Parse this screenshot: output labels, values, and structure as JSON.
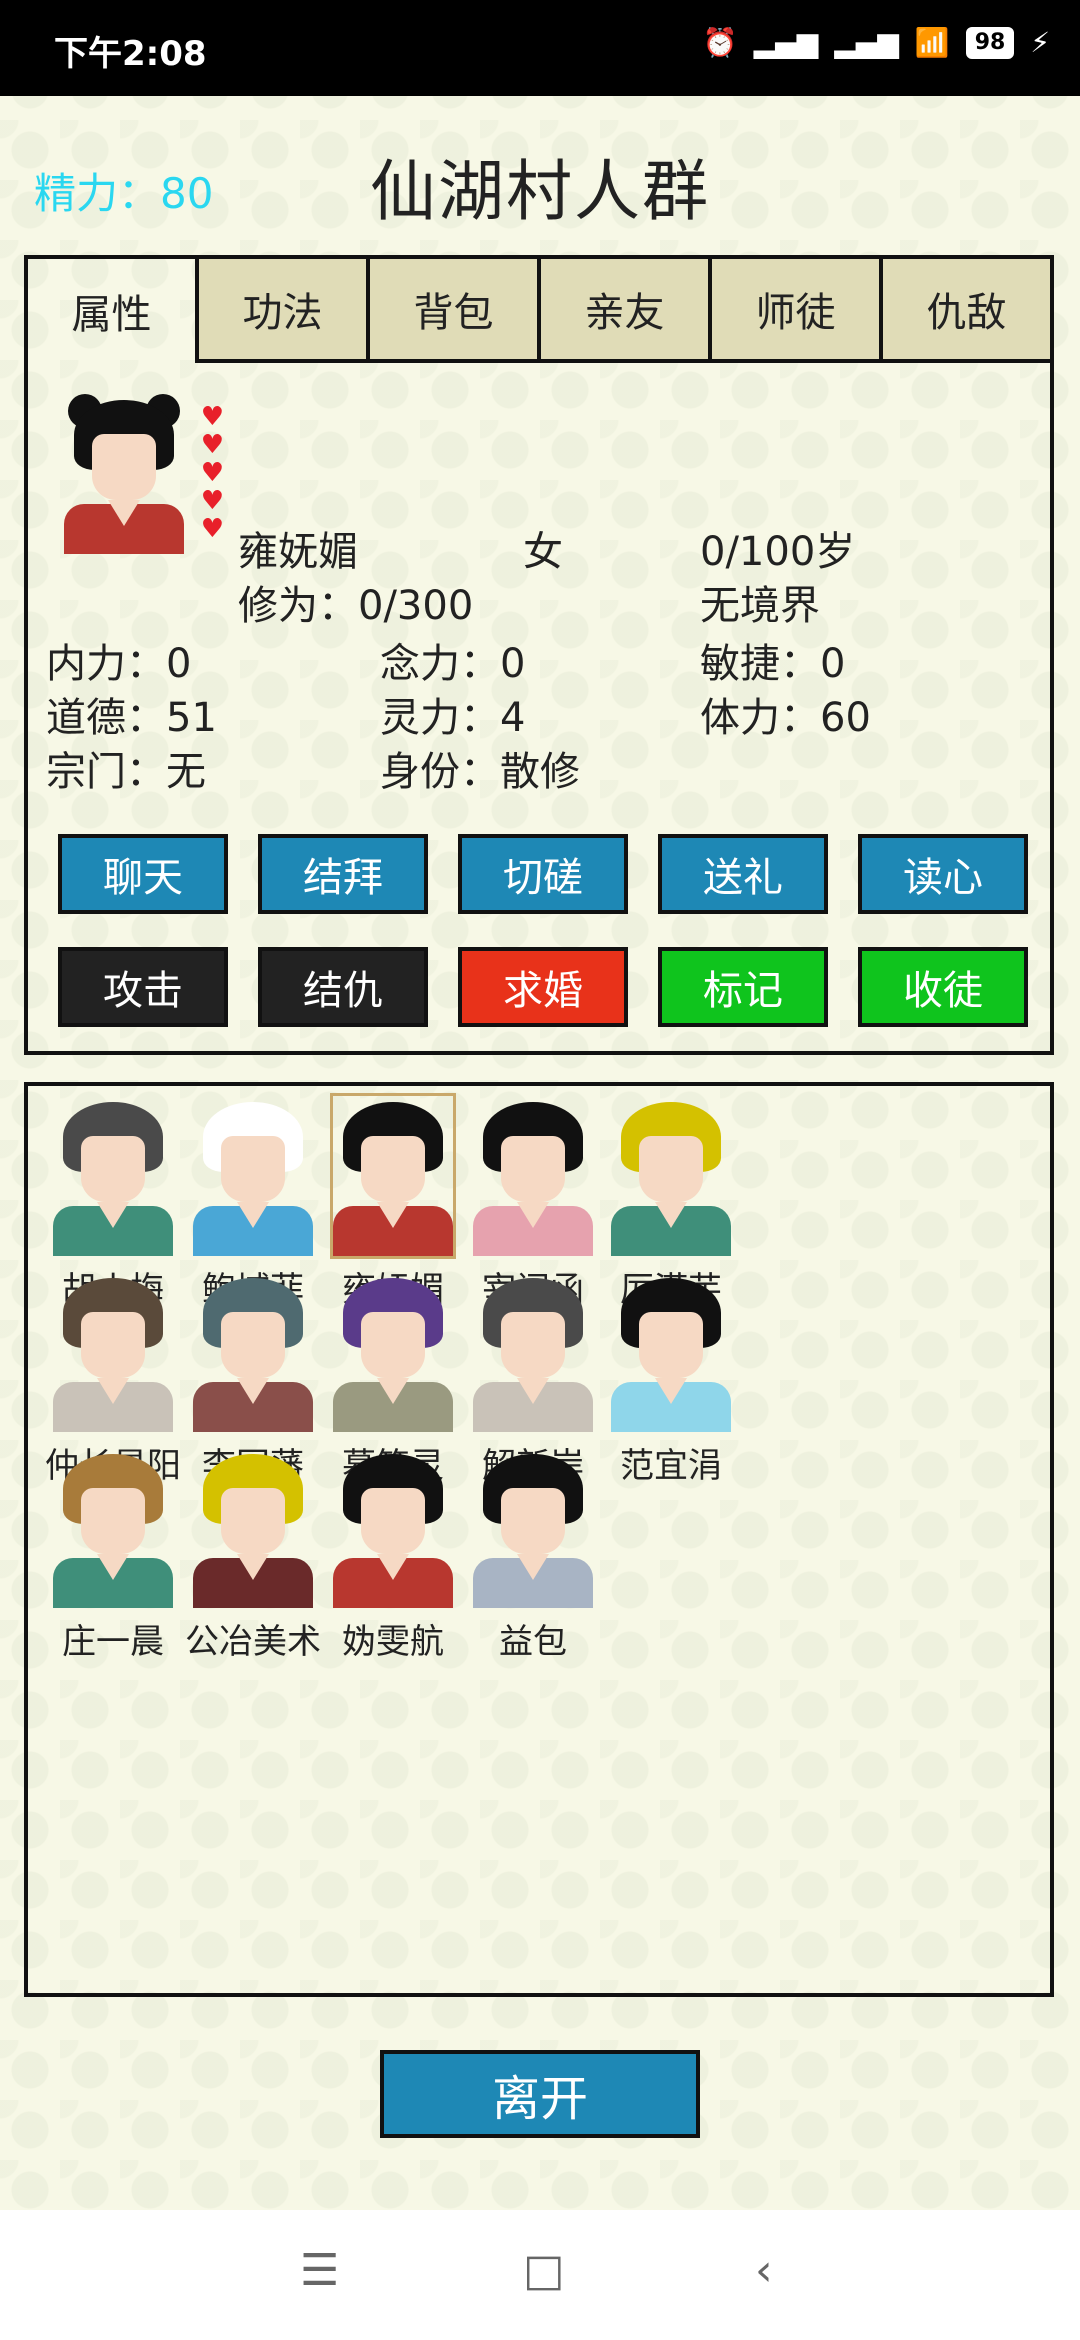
{
  "status_bar": {
    "time": "下午2:08",
    "battery": "98"
  },
  "header": {
    "energy": "精力：80",
    "title": "仙湖村人群"
  },
  "tabs": [
    "属性",
    "功法",
    "背包",
    "亲友",
    "师徒",
    "仇敌"
  ],
  "character": {
    "name": "雍妩媚",
    "gender": "女",
    "age": "0/100岁",
    "cultivation": "修为：0/300",
    "realm": "无境界",
    "stats": [
      [
        "内力：0",
        "念力：0",
        "敏捷：0"
      ],
      [
        "道德：51",
        "灵力：4",
        "体力：60"
      ],
      [
        "宗门：无",
        "身份：散修",
        ""
      ]
    ]
  },
  "actions": {
    "row1": [
      "聊天",
      "结拜",
      "切磋",
      "送礼",
      "读心"
    ],
    "row2": [
      "攻击",
      "结仇",
      "求婚",
      "标记",
      "收徒"
    ]
  },
  "roster": [
    {
      "name": "胡小梅"
    },
    {
      "name": "鲍域菲"
    },
    {
      "name": "雍妩媚"
    },
    {
      "name": "宰闻函"
    },
    {
      "name": "厉滢芋"
    },
    {
      "name": "仲长星阳"
    },
    {
      "name": "李国藩"
    },
    {
      "name": "慕笔灵"
    },
    {
      "name": "解新岸"
    },
    {
      "name": "范宜涓"
    },
    {
      "name": "庄一晨"
    },
    {
      "name": "公冶美术"
    },
    {
      "name": "妫雯航"
    },
    {
      "name": "益包"
    }
  ],
  "leave_label": "离开",
  "colors": {
    "accent_blue": "#1e88b5",
    "danger_red": "#e8321a",
    "success_green": "#0fc41d",
    "energy_cyan": "#2ad7f0",
    "heart_red": "#e8202a"
  }
}
